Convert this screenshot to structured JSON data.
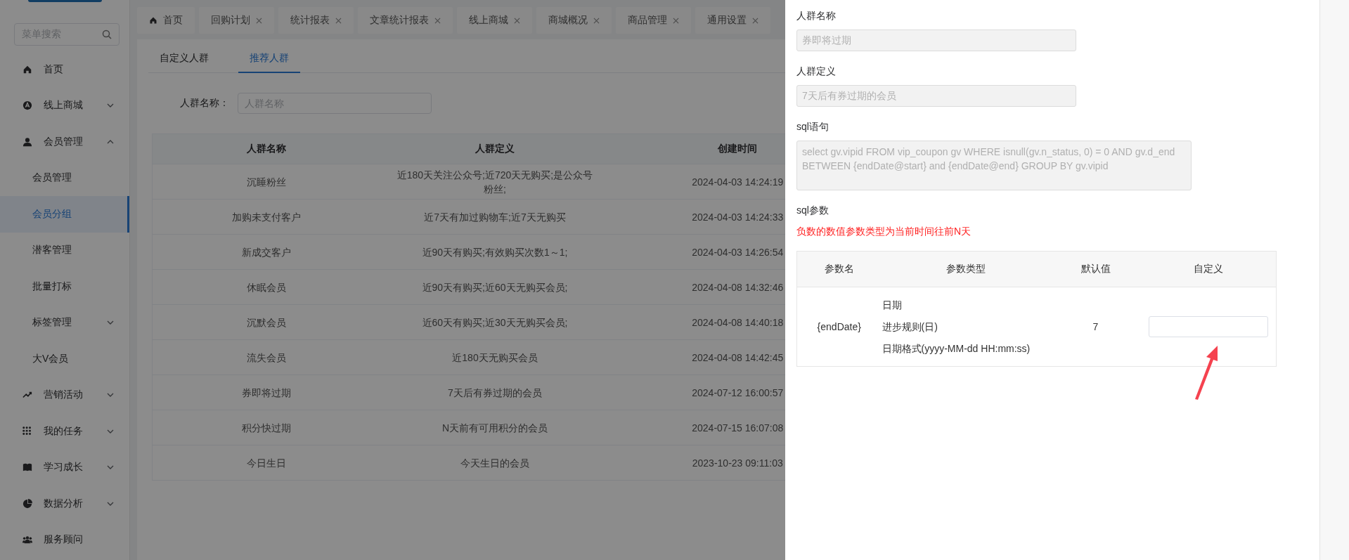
{
  "sidebar": {
    "search_placeholder": "菜单搜索",
    "items": [
      {
        "label": "首页"
      },
      {
        "label": "线上商城",
        "expanded": false
      },
      {
        "label": "会员管理",
        "expanded": true,
        "children": [
          {
            "label": "会员管理",
            "selected": false
          },
          {
            "label": "会员分组",
            "selected": true
          },
          {
            "label": "潜客管理",
            "selected": false
          },
          {
            "label": "批量打标",
            "selected": false
          },
          {
            "label": "标签管理",
            "selected": false,
            "expanded": false
          },
          {
            "label": "大V会员",
            "selected": false
          }
        ]
      },
      {
        "label": "营销活动",
        "expanded": false
      },
      {
        "label": "我的任务",
        "expanded": false
      },
      {
        "label": "学习成长",
        "expanded": false
      },
      {
        "label": "数据分析",
        "expanded": false
      },
      {
        "label": "服务顾问"
      }
    ]
  },
  "page_tabs": [
    {
      "label": "首页",
      "closable": false
    },
    {
      "label": "回购计划",
      "closable": true
    },
    {
      "label": "统计报表",
      "closable": true
    },
    {
      "label": "文章统计报表",
      "closable": true
    },
    {
      "label": "线上商城",
      "closable": true
    },
    {
      "label": "商城概况",
      "closable": true
    },
    {
      "label": "商品管理",
      "closable": true
    },
    {
      "label": "通用设置",
      "closable": true
    }
  ],
  "sub_tabs": [
    {
      "label": "自定义人群",
      "selected": false
    },
    {
      "label": "推荐人群",
      "selected": true
    }
  ],
  "filter": {
    "label": "人群名称：",
    "placeholder": "人群名称"
  },
  "table": {
    "columns": [
      "人群名称",
      "人群定义",
      "创建时间"
    ],
    "rows": [
      [
        "沉睡粉丝",
        "近180天关注公众号;近720天无购买;是公众号粉丝;",
        "2024-04-03 14:24:19"
      ],
      [
        "加购未支付客户",
        "近7天有加过购物车;近7天无购买",
        "2024-04-03 14:24:33"
      ],
      [
        "新成交客户",
        "近90天有购买;有效购买次数1～1;",
        "2024-04-03 14:26:54"
      ],
      [
        "休眠会员",
        "近90天有购买;近60天无购买会员;",
        "2024-04-08 14:32:46"
      ],
      [
        "沉默会员",
        "近60天有购买;近30天无购买会员;",
        "2024-04-08 14:40:18"
      ],
      [
        "流失会员",
        "近180天无购买会员",
        "2024-04-08 14:42:45"
      ],
      [
        "券即将过期",
        "7天后有券过期的会员",
        "2024-07-12 16:00:57"
      ],
      [
        "积分快过期",
        "N天前有可用积分的会员",
        "2024-07-15 16:07:08"
      ],
      [
        "今日生日",
        "今天生日的会员",
        "2023-10-23 09:11:03"
      ]
    ]
  },
  "drawer": {
    "fields": [
      {
        "label": "人群名称",
        "kind": "input",
        "value": "券即将过期"
      },
      {
        "label": "人群定义",
        "kind": "input",
        "value": "7天后有券过期的会员"
      },
      {
        "label": "sql语句",
        "kind": "textarea",
        "value": "select gv.vipid FROM vip_coupon gv WHERE isnull(gv.n_status, 0) = 0 AND gv.d_end BETWEEN {endDate@start} and {endDate@end} GROUP BY gv.vipid"
      }
    ],
    "params_label": "sql参数",
    "note": "负数的数值参数类型为当前时间往前N天",
    "param_table": {
      "columns": [
        "参数名",
        "参数类型",
        "默认值",
        "自定义"
      ],
      "rows": [
        {
          "name": "{endDate}",
          "type_lines": [
            "日期",
            "进步规则(日)",
            "日期格式(yyyy-MM-dd HH:mm:ss)"
          ],
          "default": "7"
        }
      ]
    }
  }
}
